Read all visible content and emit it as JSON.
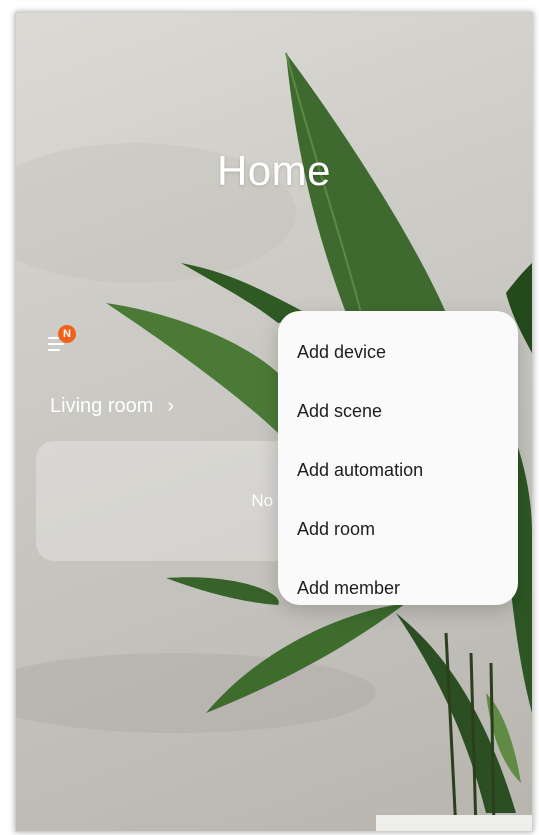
{
  "header": {
    "title": "Home"
  },
  "menu_button": {
    "icon": "menu-icon",
    "badge": "N",
    "badge_color": "#f0621b"
  },
  "room": {
    "name": "Living room",
    "chevron_icon": "chevron-right-icon",
    "card_text": "No de"
  },
  "popup_menu": {
    "items": [
      {
        "label": "Add device"
      },
      {
        "label": "Add scene"
      },
      {
        "label": "Add automation"
      },
      {
        "label": "Add room"
      },
      {
        "label": "Add member"
      }
    ]
  }
}
